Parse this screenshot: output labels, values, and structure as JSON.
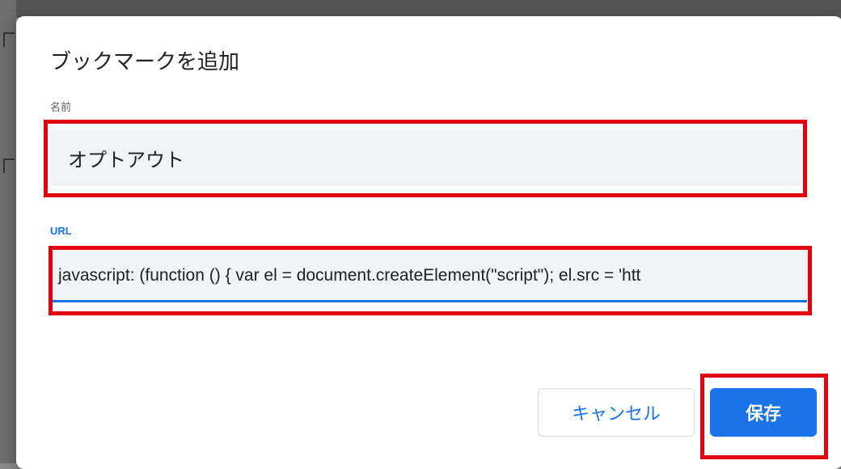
{
  "dialog": {
    "title": "ブックマークを追加",
    "name_label": "名前",
    "name_value": "オプトアウト",
    "url_label": "URL",
    "url_value": "javascript: (function () {   var el = document.createElement(\"script\");   el.src = 'htt",
    "cancel_label": "キャンセル",
    "save_label": "保存"
  },
  "colors": {
    "accent": "#1a73e8",
    "annotation": "#e0000f",
    "field_bg": "#f1f3f4"
  }
}
